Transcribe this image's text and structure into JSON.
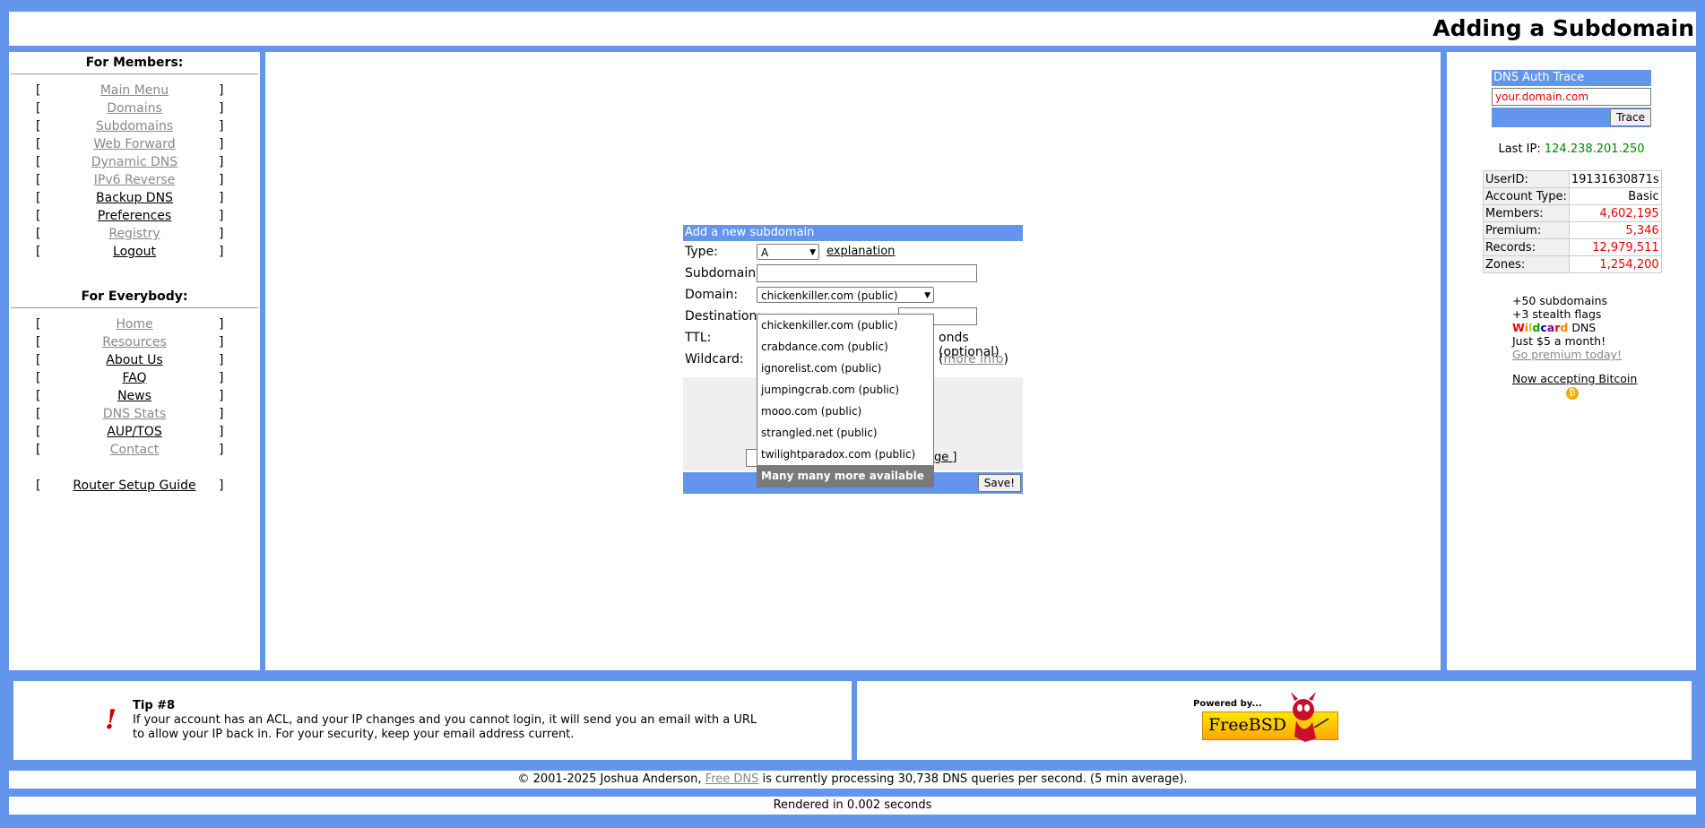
{
  "header": {
    "title": "Adding a Subdomain"
  },
  "members": {
    "title": "For Members:",
    "items": [
      {
        "label": "Main Menu"
      },
      {
        "label": "Domains"
      },
      {
        "label": "Subdomains"
      },
      {
        "label": "Web Forward"
      },
      {
        "label": "Dynamic DNS"
      },
      {
        "label": "IPv6 Reverse"
      },
      {
        "label": "Backup DNS"
      },
      {
        "label": "Preferences"
      },
      {
        "label": "Registry"
      },
      {
        "label": "Logout"
      }
    ]
  },
  "everybody": {
    "title": "For Everybody:",
    "items": [
      {
        "label": "Home"
      },
      {
        "label": "Resources"
      },
      {
        "label": "About Us"
      },
      {
        "label": "FAQ"
      },
      {
        "label": "News"
      },
      {
        "label": "DNS Stats"
      },
      {
        "label": "AUP/TOS"
      },
      {
        "label": "Contact"
      }
    ],
    "router_guide": "Router Setup Guide"
  },
  "brackets": {
    "open": "[",
    "close": "]"
  },
  "form": {
    "heading": "Add a new subdomain",
    "type_label": "Type:",
    "type_value": "A",
    "explanation_link": "explanation",
    "subdomain_label": "Subdomain:",
    "subdomain_value": "",
    "domain_label": "Domain:",
    "domain_value": "chickenkiller.com (public)",
    "destination_label": "Destination:",
    "ttl_label": "TTL:",
    "ttl_suffix": "onds (optional)",
    "wildcard_label": "Wildcard:",
    "more_info": "more info",
    "ge_fragment": "ge ]",
    "save_label": "Save!"
  },
  "domain_dropdown": {
    "options": [
      "chickenkiller.com (public)",
      "crabdance.com (public)",
      "ignorelist.com (public)",
      "jumpingcrab.com (public)",
      "mooo.com (public)",
      "strangled.net (public)",
      "twilightparadox.com (public)",
      "Many many more available ..."
    ]
  },
  "trace": {
    "heading": "DNS Auth Trace",
    "input_value": "your.domain.com",
    "button": "Trace"
  },
  "last_ip": {
    "label": "Last IP:",
    "value": "124.238.201.250"
  },
  "stats": [
    {
      "label": "UserID:",
      "value": "19131630871s"
    },
    {
      "label": "Account Type:",
      "value": "Basic"
    },
    {
      "label": "Members:",
      "value": "4,602,195"
    },
    {
      "label": "Premium:",
      "value": "5,346"
    },
    {
      "label": "Records:",
      "value": "12,979,511"
    },
    {
      "label": "Zones:",
      "value": "1,254,200"
    }
  ],
  "promo": {
    "line1": "+50 subdomains",
    "line2": "+3 stealth flags",
    "wildcard_word": "Wildcard",
    "dns_word": "DNS",
    "line4": "Just $5 a month!",
    "link": "Go premium today!",
    "bitcoin": "Now accepting Bitcoin"
  },
  "tip": {
    "title": "Tip #8",
    "icon": "!",
    "text": "If your account has an ACL, and your IP changes and you cannot login, it will send you an email with a URL to allow your IP back in. For your security, keep your email address current."
  },
  "powered": {
    "text": "Powered by...",
    "logo_text": "FreeBSD"
  },
  "footer": {
    "copyright_pre": "© 2001-2025 Joshua Anderson,",
    "free_dns": "Free DNS",
    "copyright_post": "is currently processing 30,738 DNS queries per second. (5 min average).",
    "rendered": "Rendered in 0.002 seconds"
  },
  "colors": {
    "accent": "#6495ed",
    "alert": "#e00000",
    "ip": "#008800"
  }
}
